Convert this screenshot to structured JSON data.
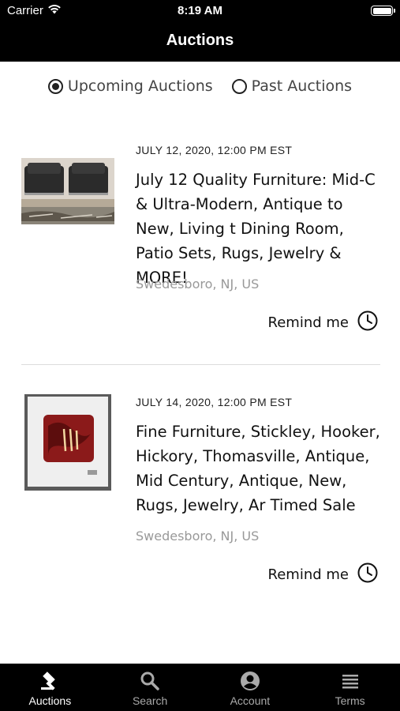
{
  "status_bar": {
    "carrier": "Carrier",
    "time": "8:19 AM"
  },
  "nav": {
    "title": "Auctions"
  },
  "filter": {
    "options": [
      {
        "label": "Upcoming Auctions",
        "selected": true
      },
      {
        "label": "Past Auctions",
        "selected": false
      }
    ]
  },
  "auctions": [
    {
      "date": "JULY 12, 2020, 12:00 PM EST",
      "title": "July 12 Quality Furniture: Mid-C & Ultra-Modern, Antique to New, Living t Dining Room, Patio Sets, Rugs, Jewelry & MORE!",
      "location": "Swedesboro, NJ, US",
      "remind_label": "Remind me",
      "thumb_icon": "armchairs-photo"
    },
    {
      "date": "JULY 14, 2020, 12:00 PM EST",
      "title": "Fine Furniture, Stickley, Hooker, Hickory, Thomasville, Antique, Mid Century, Antique, New, Rugs, Jewelry, Ar Timed Sale",
      "location": "Swedesboro, NJ, US",
      "remind_label": "Remind me",
      "thumb_icon": "framed-art-photo"
    }
  ],
  "tabs": [
    {
      "label": "Auctions",
      "icon": "gavel-icon",
      "active": true
    },
    {
      "label": "Search",
      "icon": "search-icon",
      "active": false
    },
    {
      "label": "Account",
      "icon": "account-icon",
      "active": false
    },
    {
      "label": "Terms",
      "icon": "list-icon",
      "active": false
    }
  ]
}
